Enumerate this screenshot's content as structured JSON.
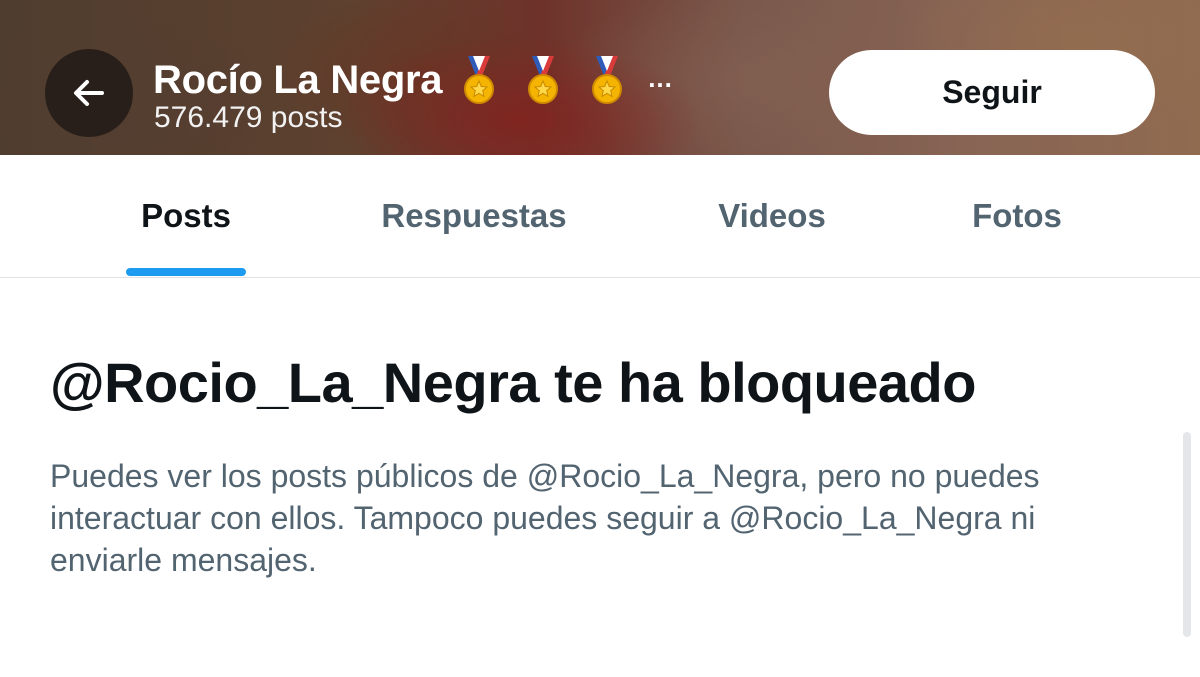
{
  "header": {
    "display_name": "Rocío La Negra",
    "badges": [
      "sports-medal-icon",
      "sports-medal-icon",
      "sports-medal-icon"
    ],
    "truncation": "...",
    "post_count": "576.479 posts",
    "follow_label": "Seguir",
    "back_icon": "arrow-left-icon"
  },
  "tabs": [
    {
      "label": "Posts",
      "active": true
    },
    {
      "label": "Respuestas",
      "active": false
    },
    {
      "label": "Videos",
      "active": false
    },
    {
      "label": "Fotos",
      "active": false
    }
  ],
  "blocked": {
    "title": "@Rocio_La_Negra te ha bloqueado",
    "description": "Puedes ver los posts públicos de @Rocio_La_Negra, pero no puedes interactuar con ellos. Tampoco puedes seguir a @Rocio_La_Negra ni enviarle mensajes."
  },
  "colors": {
    "accent": "#1d9bf0",
    "text_primary": "#0f1419",
    "text_secondary": "#536471"
  }
}
